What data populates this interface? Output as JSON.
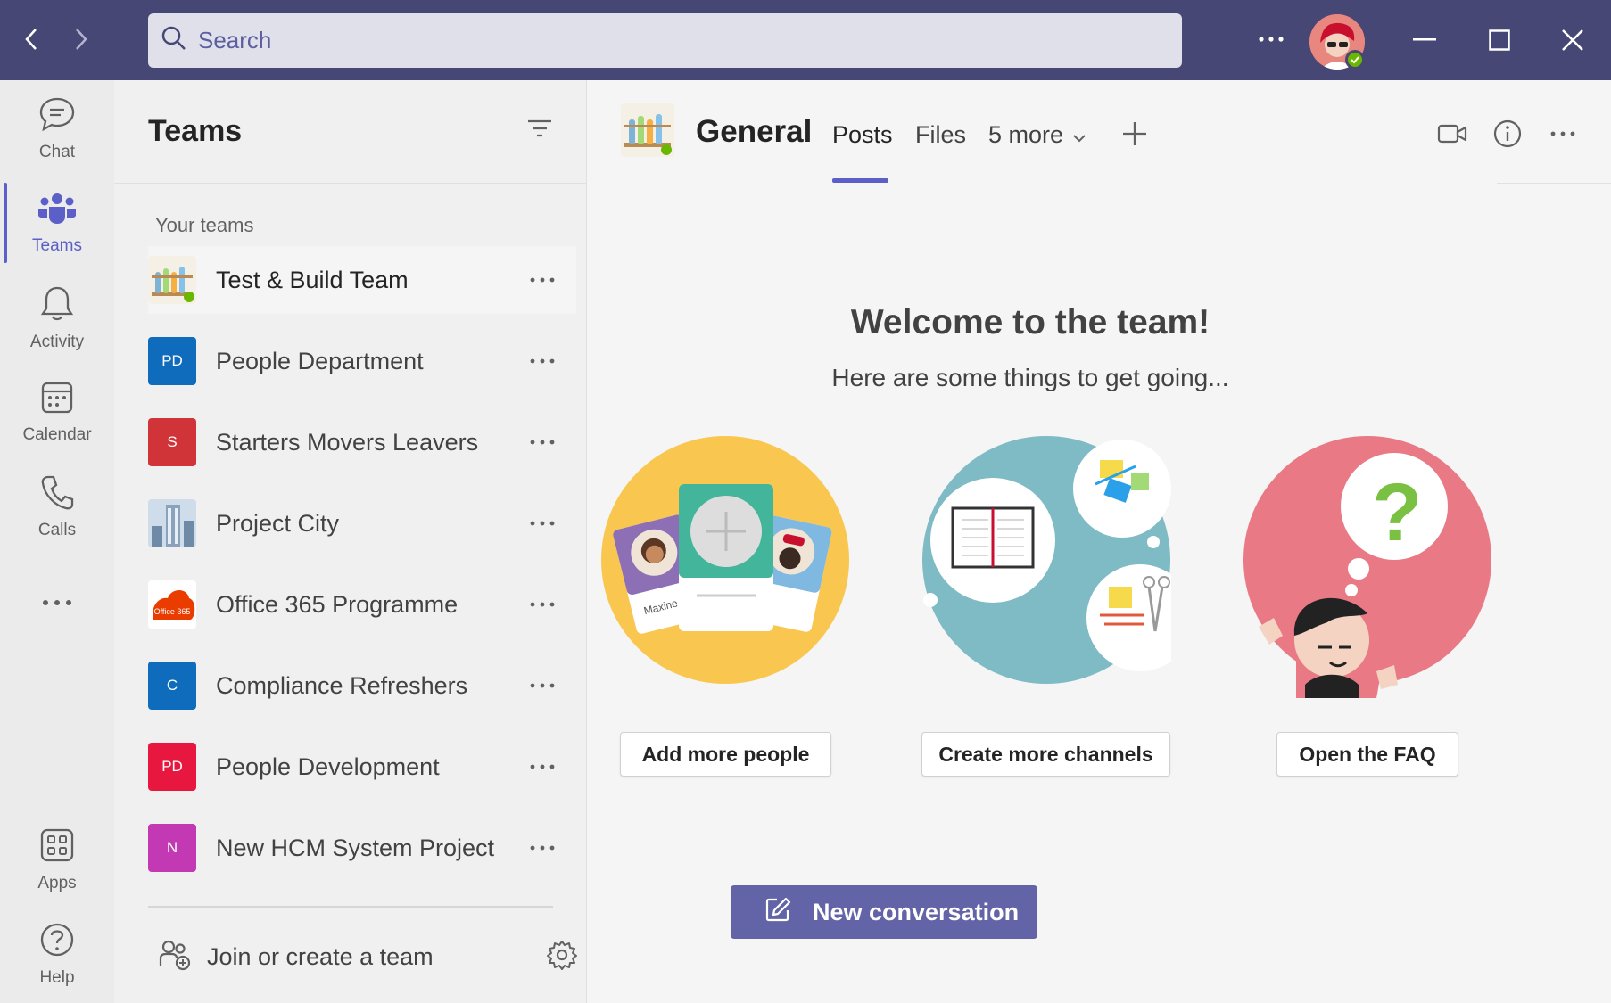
{
  "titlebar": {
    "search_placeholder": "Search",
    "colors": {
      "bar": "#464775",
      "search_bg": "#e0e0ea"
    }
  },
  "rail": {
    "items": [
      {
        "label": "Chat",
        "icon": "chat-icon"
      },
      {
        "label": "Teams",
        "icon": "teams-icon",
        "active": true
      },
      {
        "label": "Activity",
        "icon": "bell-icon"
      },
      {
        "label": "Calendar",
        "icon": "calendar-icon"
      },
      {
        "label": "Calls",
        "icon": "phone-icon"
      },
      {
        "label": "",
        "icon": "more-icon"
      },
      {
        "label": "Apps",
        "icon": "apps-icon"
      },
      {
        "label": "Help",
        "icon": "help-icon"
      }
    ],
    "accent": "#5b5fc7"
  },
  "teams_panel": {
    "title": "Teams",
    "section_label": "Your teams",
    "teams": [
      {
        "name": "Test & Build Team",
        "tile": "",
        "tile_color": "#ffffff",
        "selected": true
      },
      {
        "name": "People Department",
        "tile": "PD",
        "tile_color": "#0f6cbd"
      },
      {
        "name": "Starters Movers Leavers",
        "tile": "S",
        "tile_color": "#d13438"
      },
      {
        "name": "Project City",
        "tile": "",
        "tile_color": "#9fb3c8"
      },
      {
        "name": "Office 365 Programme",
        "tile": "Office 365",
        "tile_color": "#eb3c00"
      },
      {
        "name": "Compliance Refreshers",
        "tile": "C",
        "tile_color": "#0f6cbd"
      },
      {
        "name": "People Development",
        "tile": "PD",
        "tile_color": "#e8173f"
      },
      {
        "name": "New HCM System Project",
        "tile": "N",
        "tile_color": "#c239b3"
      }
    ],
    "join_label": "Join or create a team"
  },
  "channel": {
    "title": "General",
    "tabs": [
      {
        "label": "Posts",
        "active": true
      },
      {
        "label": "Files"
      },
      {
        "label": "5 more"
      }
    ]
  },
  "welcome": {
    "title": "Welcome to the team!",
    "subtitle": "Here are some things to get going...",
    "actions": [
      {
        "label": "Add more people"
      },
      {
        "label": "Create more channels"
      },
      {
        "label": "Open the FAQ"
      }
    ],
    "illustration_names": [
      "Maxine"
    ],
    "new_conversation": "New conversation",
    "brand_color": "#6264a7"
  }
}
